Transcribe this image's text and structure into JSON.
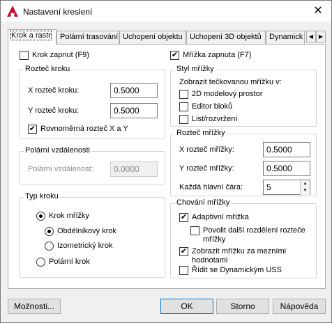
{
  "window": {
    "title": "Nastavení kreslení",
    "close_glyph": "✕"
  },
  "tabs": [
    {
      "label": "Krok a rastr",
      "active": true
    },
    {
      "label": "Polární trasování",
      "active": false
    },
    {
      "label": "Uchopení objektu",
      "active": false
    },
    {
      "label": "Uchopení 3D objektů",
      "active": false
    },
    {
      "label": "Dynamick",
      "active": false
    }
  ],
  "tab_scroll": {
    "left": "◀",
    "right": "▶"
  },
  "snap": {
    "enabled_label": "Krok zapnut (F9)",
    "enabled": false,
    "spacing_group": "Rozteč kroku",
    "x_label": "X rozteč kroku:",
    "x_value": "0.5000",
    "y_label": "Y rozteč kroku:",
    "y_value": "0.5000",
    "equal_label": "Rovnoměrná rozteč X a Y",
    "equal_checked": true,
    "polar_group": "Polární vzdálenosti",
    "polar_label": "Polární vzdálenost:",
    "polar_value": "0.0000",
    "type_group": "Typ kroku",
    "grid_snap_label": "Krok mřížky",
    "rect_label": "Obdélníkový krok",
    "iso_label": "Izometrický krok",
    "polar_snap_label": "Polární krok",
    "selected_type": "grid",
    "selected_subtype": "rect"
  },
  "grid": {
    "enabled_label": "Mřížka zapnuta (F7)",
    "enabled": true,
    "style_group": "Styl mřížky",
    "style_caption": "Zobrazit tečkovanou mřížku v:",
    "style_2d": "2D modelový prostor",
    "style_block": "Editor bloků",
    "style_sheet": "List/rozvržení",
    "spacing_group": "Rozteč mřížky",
    "x_label": "X rozteč mřížky:",
    "x_value": "0.5000",
    "y_label": "Y rozteč mřížky:",
    "y_value": "0.5000",
    "major_label": "Každá hlavní čára:",
    "major_value": "5",
    "behavior_group": "Chování mřížky",
    "adaptive_label": "Adaptivní mřížka",
    "adaptive_checked": true,
    "subdiv_label": "Povolit další rozdělení rozteče mřížky",
    "subdiv_checked": false,
    "beyond_label": "Zobrazit mřížku za mezními hodnotami",
    "beyond_checked": true,
    "ucs_label": "Řídit se Dynamickým USS",
    "ucs_checked": false
  },
  "buttons": {
    "options": "Možnosti...",
    "ok": "OK",
    "cancel": "Storno",
    "help": "Nápověda"
  },
  "colors": {
    "accent": "#0078d7",
    "app_icon": "#c8102e"
  }
}
